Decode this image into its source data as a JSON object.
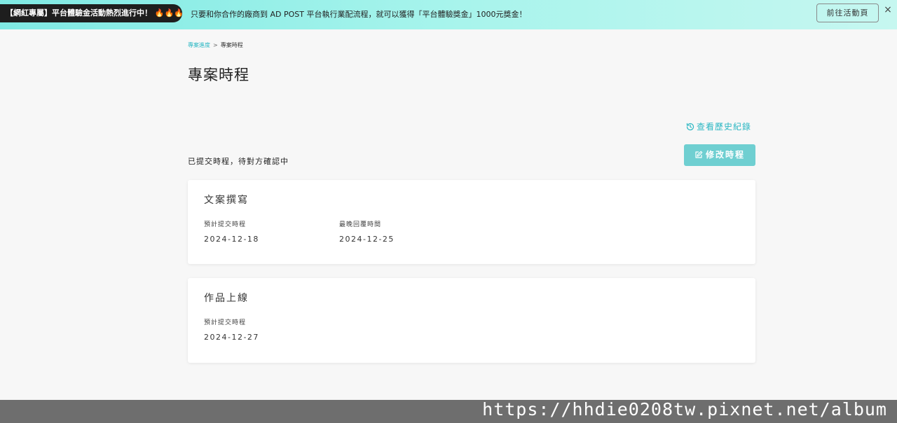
{
  "banner": {
    "promo_label": "【網紅專屬】平台體驗金活動熱烈進行中！",
    "promo_emoji": "🔥🔥🔥",
    "message": "只要和你合作的廠商到 AD POST 平台執行業配流程，就可以獲得「平台體驗獎金」1000元獎金！",
    "event_button": "前往活動頁",
    "close_symbol": "×"
  },
  "breadcrumb": {
    "parent": "專案進度",
    "separator": ">",
    "current": "專案時程"
  },
  "page": {
    "title": "專案時程",
    "history_link": "查看歷史紀錄",
    "edit_button": "修改時程",
    "status": "已提交時程，待對方確認中"
  },
  "schedule": [
    {
      "title": "文案撰寫",
      "fields": [
        {
          "label": "預計提交時程",
          "value": "2024-12-18"
        },
        {
          "label": "最晚回覆時間",
          "value": "2024-12-25"
        }
      ]
    },
    {
      "title": "作品上線",
      "fields": [
        {
          "label": "預計提交時程",
          "value": "2024-12-27"
        }
      ]
    }
  ],
  "watermark": "https://hhdie0208tw.pixnet.net/album",
  "colors": {
    "accent": "#2bb7c3",
    "button": "#6fcfd1",
    "banner_start": "#7fe9e3",
    "banner_end": "#c6f7f0",
    "footer": "#6e6e6e"
  },
  "icons": {
    "history": "history-clock-icon",
    "edit": "edit-square-icon",
    "close": "close-icon",
    "fire": "fire-icon"
  }
}
